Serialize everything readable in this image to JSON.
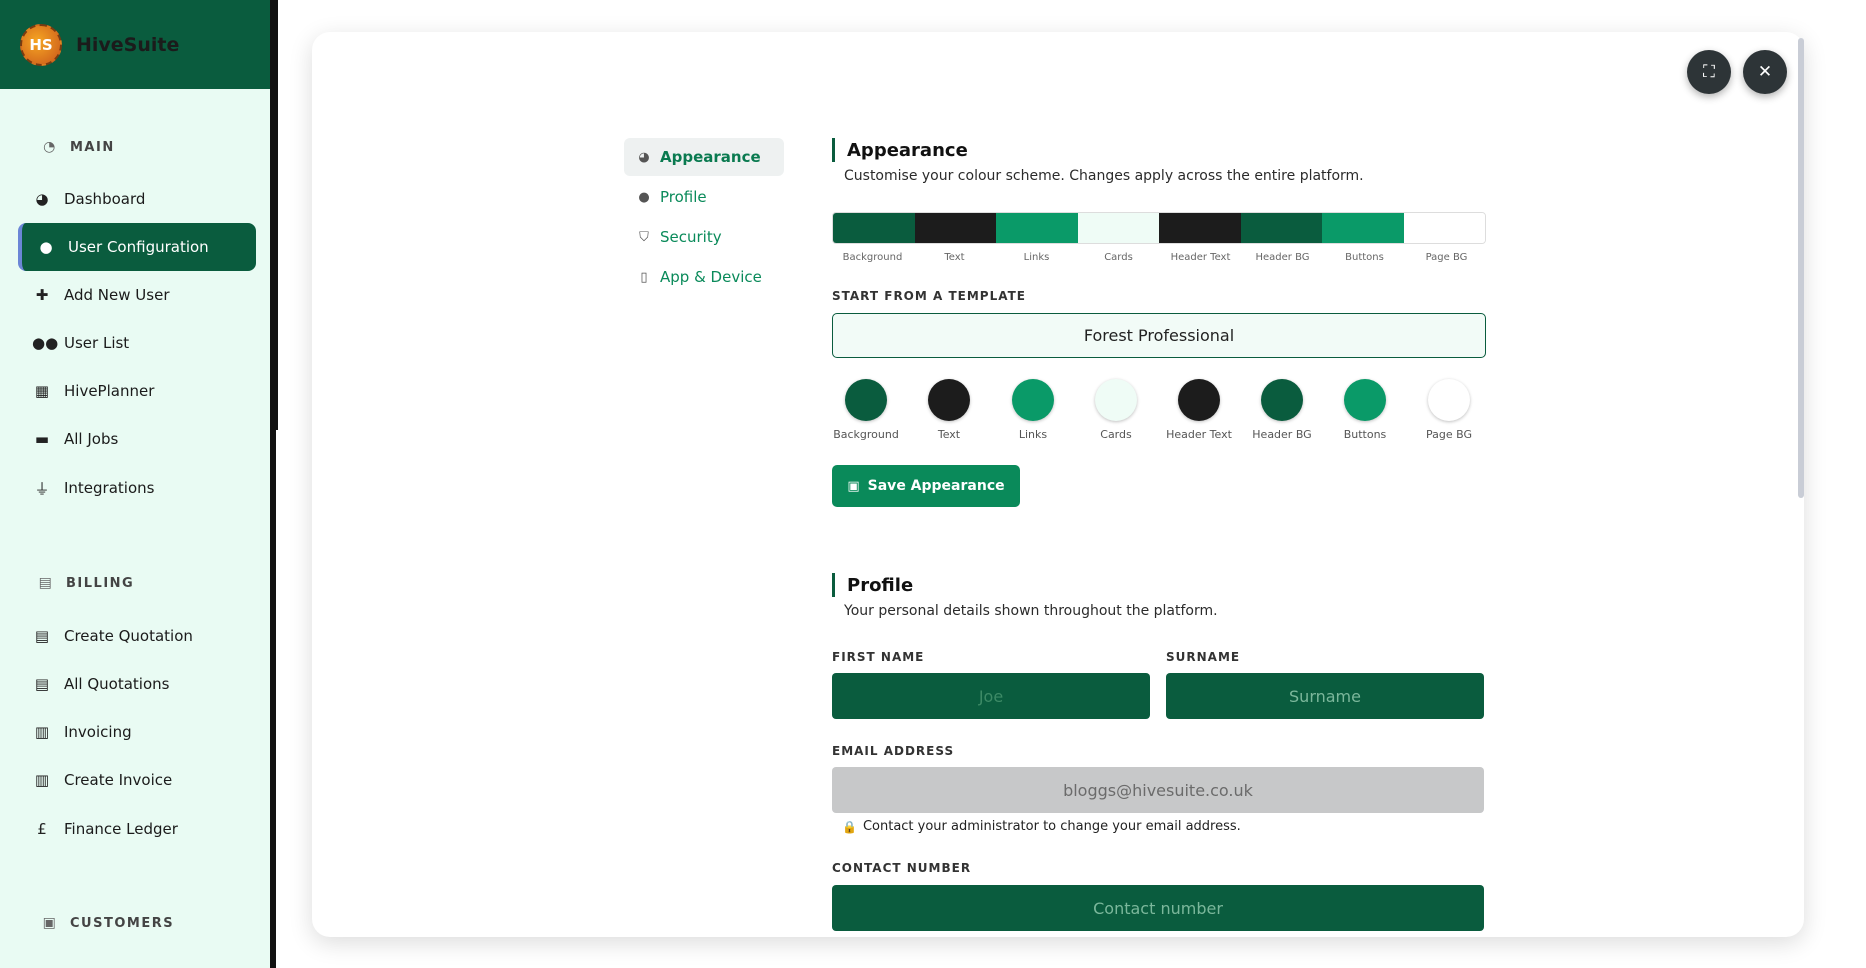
{
  "app": {
    "name": "HiveSuite",
    "logo_text": "HS"
  },
  "sidebar": {
    "main_title": "MAIN",
    "billing_title": "BILLING",
    "customers_title": "CUSTOMERS",
    "main_items": [
      {
        "label": "Dashboard",
        "icon": "dashboard-icon"
      },
      {
        "label": "User Configuration",
        "icon": "user-icon"
      },
      {
        "label": "Add New User",
        "icon": "user-plus-icon"
      },
      {
        "label": "User List",
        "icon": "users-icon"
      },
      {
        "label": "HivePlanner",
        "icon": "calendar-icon"
      },
      {
        "label": "All Jobs",
        "icon": "briefcase-icon"
      },
      {
        "label": "Integrations",
        "icon": "plug-icon"
      }
    ],
    "billing_items": [
      {
        "label": "Create Quotation",
        "icon": "document-icon"
      },
      {
        "label": "All Quotations",
        "icon": "document-icon"
      },
      {
        "label": "Invoicing",
        "icon": "invoice-icon"
      },
      {
        "label": "Create Invoice",
        "icon": "invoice-icon"
      },
      {
        "label": "Finance Ledger",
        "icon": "pound-icon"
      }
    ]
  },
  "settings_nav": [
    {
      "label": "Appearance",
      "icon": "palette-icon"
    },
    {
      "label": "Profile",
      "icon": "user-icon"
    },
    {
      "label": "Security",
      "icon": "shield-icon"
    },
    {
      "label": "App & Device",
      "icon": "mobile-icon"
    }
  ],
  "appearance": {
    "title": "Appearance",
    "description": "Customise your colour scheme. Changes apply across the entire platform.",
    "template_label": "START FROM A TEMPLATE",
    "template_value": "Forest Professional",
    "colors": [
      {
        "label": "Background",
        "hex": "#0a5c3e"
      },
      {
        "label": "Text",
        "hex": "#1c1c1c"
      },
      {
        "label": "Links",
        "hex": "#0a9a68"
      },
      {
        "label": "Cards",
        "hex": "#effcf6"
      },
      {
        "label": "Header Text",
        "hex": "#1c1c1c"
      },
      {
        "label": "Header BG",
        "hex": "#0a5c3e"
      },
      {
        "label": "Buttons",
        "hex": "#0a9a68"
      },
      {
        "label": "Page BG",
        "hex": "#ffffff"
      }
    ],
    "save_label": "Save Appearance"
  },
  "profile": {
    "title": "Profile",
    "description": "Your personal details shown throughout the platform.",
    "first_name_label": "FIRST NAME",
    "first_name_value": "Joe",
    "surname_label": "SURNAME",
    "surname_placeholder": "Surname",
    "email_label": "EMAIL ADDRESS",
    "email_value": "bloggs@hivesuite.co.uk",
    "email_note": "Contact your administrator to change your email address.",
    "contact_label": "CONTACT NUMBER",
    "contact_placeholder": "Contact number"
  }
}
